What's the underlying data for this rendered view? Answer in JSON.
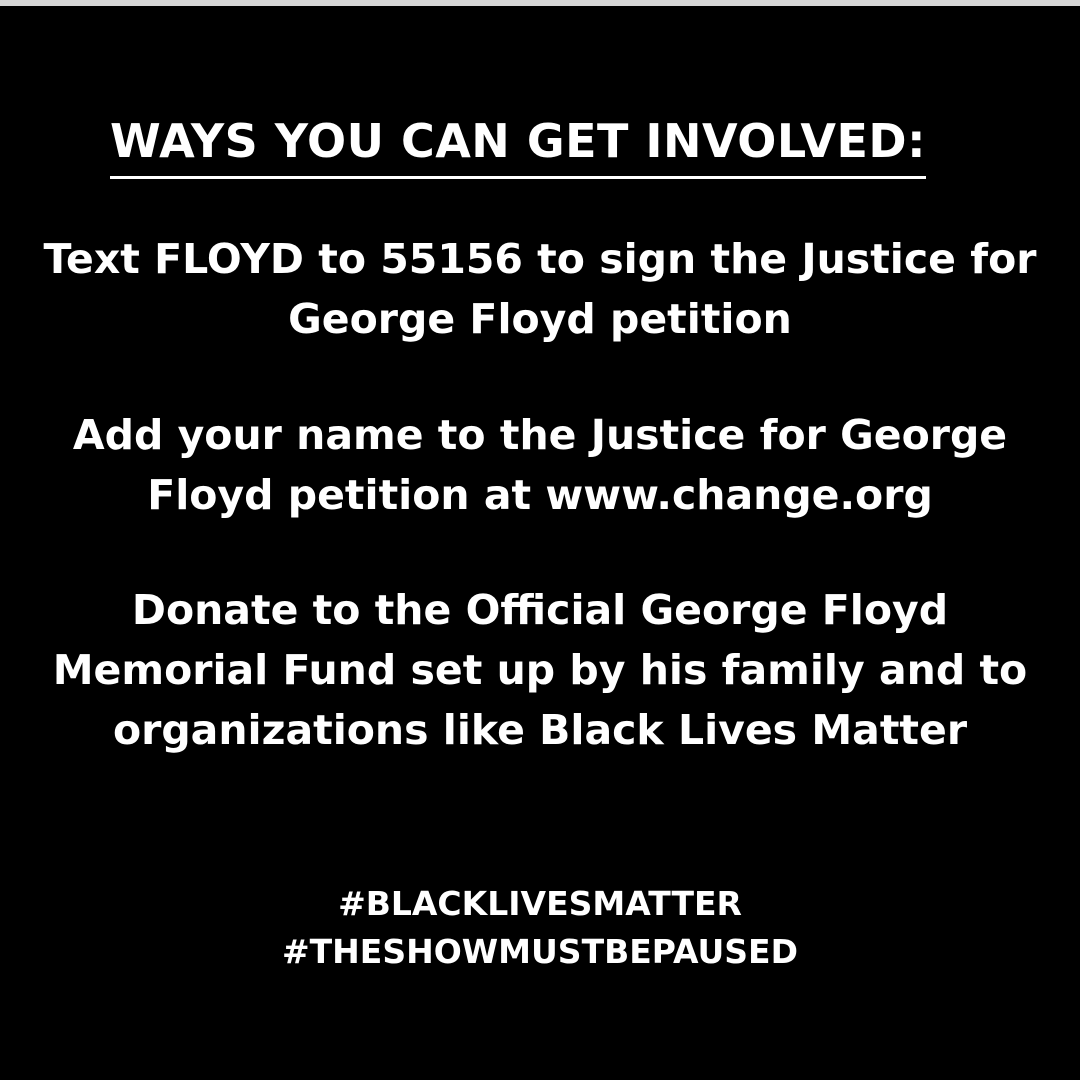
{
  "heading": "WAYS YOU CAN GET INVOLVED:",
  "items": [
    {
      "lines": [
        "Text FLOYD to 55156 to sign the Justice for",
        "George Floyd petition"
      ]
    },
    {
      "lines": [
        "Add your name to the Justice for George",
        "Floyd petition at www.change.org"
      ]
    },
    {
      "lines": [
        "Donate to the Official George Floyd",
        "Memorial Fund set up by his family and to",
        "organizations like Black Lives Matter"
      ]
    }
  ],
  "hashtags": [
    "#BLACKLIVESMATTER",
    "#THESHOWMUSTBEPAUSED"
  ],
  "colors": {
    "background": "#000000",
    "text": "#ffffff",
    "top_strip": "#d6d6d6"
  }
}
